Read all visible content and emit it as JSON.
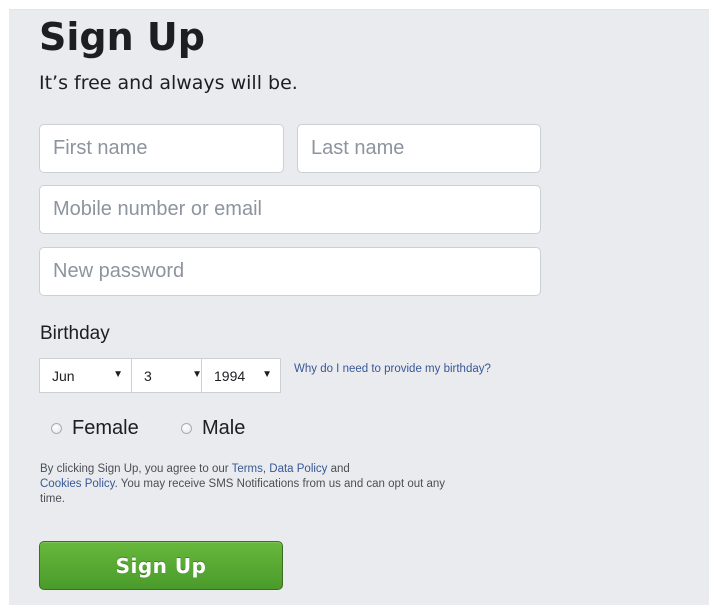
{
  "header": {
    "title": "Sign Up",
    "subtitle": "It’s free and always will be."
  },
  "form": {
    "first_name": {
      "placeholder": "First name",
      "value": ""
    },
    "last_name": {
      "placeholder": "Last name",
      "value": ""
    },
    "mobile_or_email": {
      "placeholder": "Mobile number or email",
      "value": ""
    },
    "password": {
      "placeholder": "New password",
      "value": ""
    }
  },
  "birthday": {
    "label": "Birthday",
    "month": "Jun",
    "day": "3",
    "year": "1994",
    "help_link": "Why do I need to provide my birthday?"
  },
  "gender": {
    "female": "Female",
    "male": "Male"
  },
  "legal": {
    "prefix": "By clicking Sign Up, you agree to our ",
    "terms": "Terms",
    "sep": ", ",
    "data_policy": "Data Policy",
    "and": " and ",
    "cookies_policy": "Cookies Policy",
    "suffix": ". You may receive SMS Notifications from us and can opt out any time."
  },
  "submit": {
    "label": "Sign Up"
  },
  "colors": {
    "background": "#e9ebee",
    "link": "#385898",
    "button_green": "#4a9b2b"
  }
}
